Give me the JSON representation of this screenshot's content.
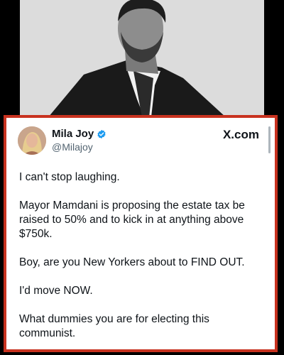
{
  "tweet": {
    "author_name": "Mila Joy",
    "author_handle": "@Milajoy",
    "source_label": "X.com",
    "verified": true,
    "paragraphs": [
      "I can't stop laughing.",
      "Mayor Mamdani is proposing the estate tax be raised to 50% and to kick in at anything above $750k.",
      "Boy, are you New Yorkers about to FIND OUT.",
      "I'd move NOW.",
      "What dummies you are for electing this communist."
    ]
  },
  "colors": {
    "frame_border": "#c8321f",
    "verified_badge": "#1d9bf0",
    "background": "#000000"
  },
  "icons": {
    "verified": "verified-badge-icon"
  }
}
